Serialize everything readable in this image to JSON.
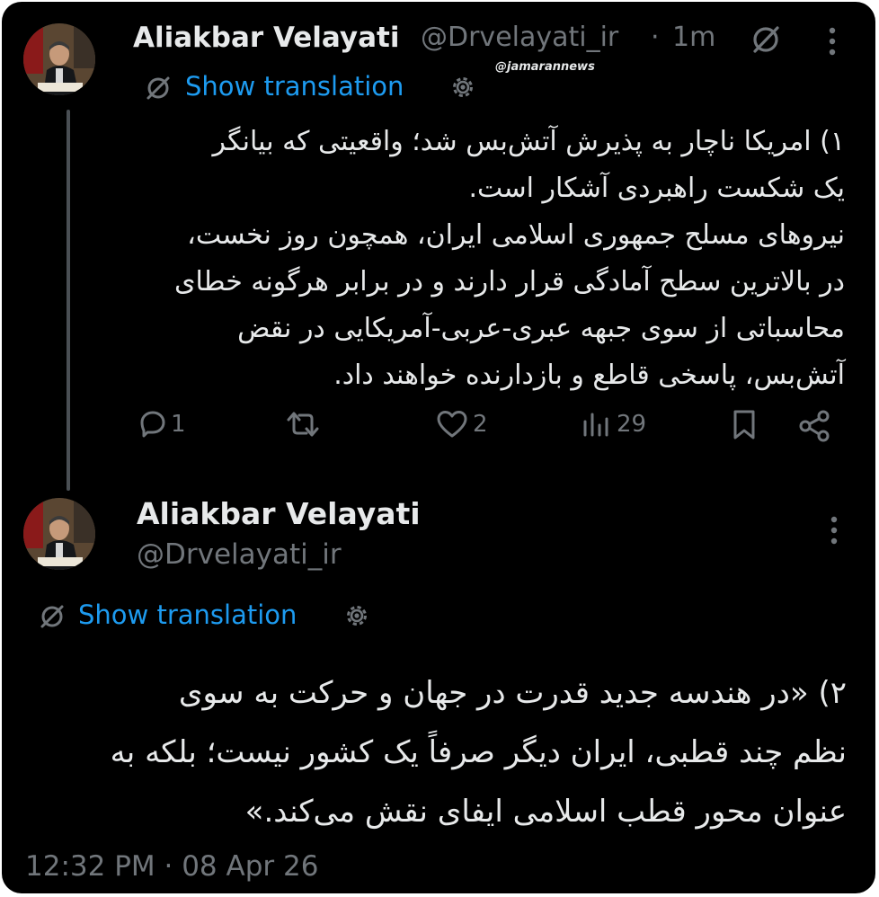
{
  "post1": {
    "author_name": "Aliakbar Velayati",
    "handle": "@Drvelayati_ir",
    "separator": "·",
    "time_ago": "1m",
    "show_translation": "Show translation",
    "body": [
      "۱) امریکا ناچار به پذیرش آتش‌بس شد؛ واقعیتی که بیانگر",
      "یک شکست راهبردی آشکار است.",
      "نیروهای مسلح جمهوری اسلامی ایران، همچون روز نخست،",
      "در بالاترین سطح آمادگی قرار دارند و در برابر هرگونه خطای",
      "محاسباتی از سوی جبهه عبری-عربی-آمریکایی در نقض",
      "آتش‌بس، پاسخی قاطع و بازدارنده خواهند داد."
    ],
    "stats": {
      "replies": "1",
      "likes": "2",
      "views": "29"
    }
  },
  "watermark": "@jamarannews",
  "post2": {
    "author_name": "Aliakbar Velayati",
    "handle": "@Drvelayati_ir",
    "show_translation": "Show translation",
    "body": [
      "۲) «در هندسه جدید قدرت در جهان و حرکت به سوی",
      "نظم چند قطبی، ایران دیگر صرفاً یک کشور نیست؛ بلکه به",
      "عنوان محور قطب اسلامی ایفای نقش می‌کند.»"
    ],
    "timestamp": "12:32 PM · 08 Apr 26"
  },
  "colors": {
    "background": "#000000",
    "text": "#e7e9ea",
    "muted": "#71767b",
    "link": "#1d9bf0",
    "thread_line": "#4a4f54"
  },
  "icons": [
    "grok-slash-icon",
    "gear-icon",
    "more-vertical-icon",
    "reply-icon",
    "repost-icon",
    "like-icon",
    "views-icon",
    "bookmark-icon",
    "share-icon"
  ]
}
